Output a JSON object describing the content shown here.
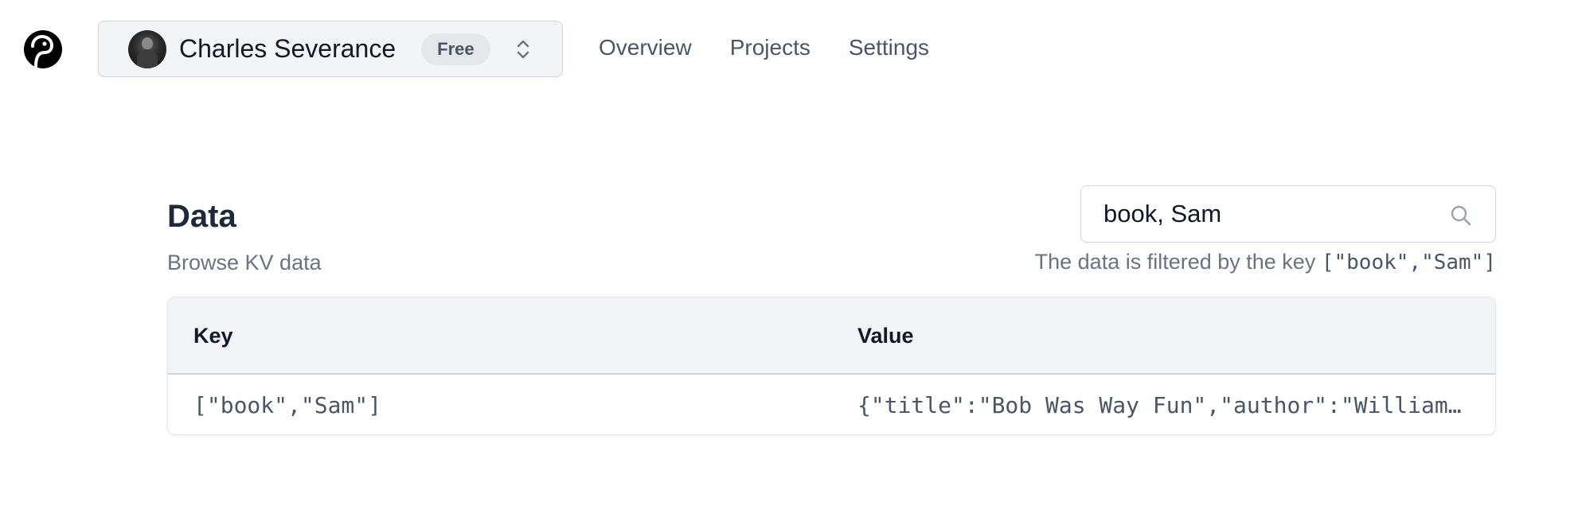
{
  "nav": {
    "account_name": "Charles Severance",
    "plan": "Free",
    "links": [
      "Overview",
      "Projects",
      "Settings"
    ]
  },
  "main": {
    "title": "Data",
    "subtitle": "Browse KV data",
    "search": {
      "value": "book, Sam"
    },
    "filter_note": {
      "prefix": "The data is filtered by the key ",
      "key": "[\"book\",\"Sam\"]"
    },
    "table": {
      "headers": [
        "Key",
        "Value"
      ],
      "rows": [
        {
          "key": "[\"book\",\"Sam\"]",
          "value": "{\"title\":\"Bob Was Way Fun\",\"author\":\"William…"
        }
      ]
    }
  },
  "icons": {
    "logo": "logo-icon",
    "switcher": "chevron-up-down-icon",
    "search": "search-icon"
  }
}
